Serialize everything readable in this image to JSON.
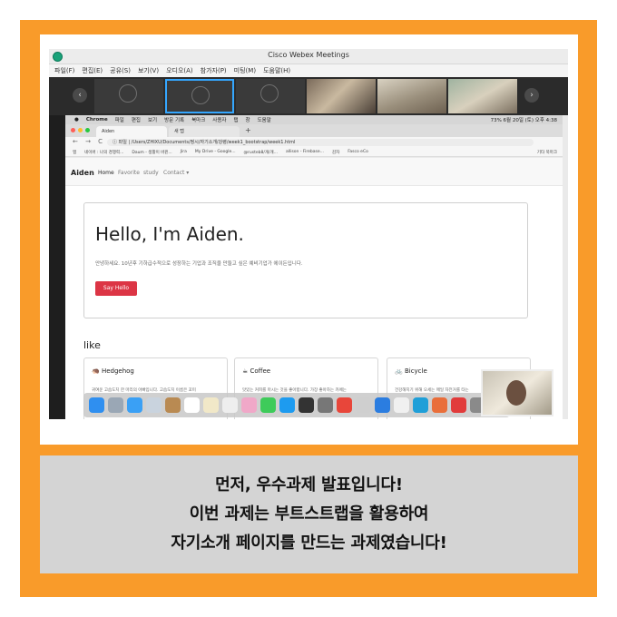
{
  "caption": {
    "line1": "먼저, 우수과제 발표입니다!",
    "line2": "이번 과제는 부트스트랩을 활용하여",
    "line3": "자기소개 페이지를 만드는 과제였습니다!"
  },
  "webex": {
    "title": "Cisco Webex Meetings",
    "menu": [
      "파일(F)",
      "편집(E)",
      "공유(S)",
      "보기(V)",
      "오디오(A)",
      "참가자(P)",
      "미팅(M)",
      "도움말(H)"
    ],
    "prev_arrow": "‹",
    "next_arrow": "›"
  },
  "mac_menu": {
    "apple": "",
    "items": [
      "Chrome",
      "파일",
      "편집",
      "보기",
      "방문 기록",
      "북마크",
      "사용자",
      "탭",
      "창",
      "도움말"
    ],
    "status": "73%  6월 20일 (토) 오후 4:38"
  },
  "browser": {
    "tabs": [
      "Aiden",
      "새 탭"
    ],
    "add_tab": "+",
    "nav": "← → C ⌂",
    "url": "ⓘ 파일 | /Users/ZHIXU/Documents/정시/자기소개/강령/week1_bootstrap/week1.html",
    "bookmarks": [
      "앱",
      "네이버 : 나의 경쟁력...",
      "Daum - 생활이 바뀐...",
      "Jira",
      "My Drive - Google...",
      "@rusteb8/개/개...",
      "allison - Firebase...",
      "감자",
      "Fasco eCo",
      "기타 북마크"
    ]
  },
  "site": {
    "brand": "Aiden",
    "nav": [
      "Home",
      "Favorite",
      "study",
      "Contact ▾"
    ],
    "heading": "Hello, I'm Aiden.",
    "intro": "안녕하세요. 10년후 기하급수적으로 성장하는 기업과 조직을 만들고 싶은 예비기업가 에이든입니다.",
    "button": "Say Hello",
    "like_title": "like",
    "cards": [
      {
        "title": "🦔 Hedgehog",
        "desc": "귀여운 고슴도치 한 마리의 아빠입니다. 고슴도치 이름은 꼬미"
      },
      {
        "title": "☕ Coffee",
        "desc": "맛있는 커피를 마시는 것을 좋아합니다. 가장 좋아하는 카페는"
      },
      {
        "title": "🚲 Bicycle",
        "desc": "건강해지기 위해 오세는 매일 자전거를 타는"
      }
    ]
  },
  "colors": {
    "frame": "#f99b2a",
    "caption_bg": "#d4d4d4",
    "button": "#dc3545",
    "selected_tile": "#35a7ff"
  }
}
